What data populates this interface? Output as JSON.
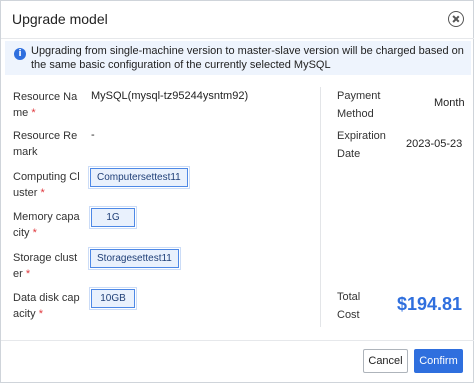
{
  "dialog": {
    "title": "Upgrade model",
    "notice": "Upgrading from single-machine version to master-slave version will be charged based on the same basic configuration of the currently selected MySQL"
  },
  "form": {
    "resource_name_label": "Resource Name",
    "resource_name_required": "*",
    "resource_name_value": "MySQL(mysql-tz95244ysntm92)",
    "resource_remark_label": "Resource Remark",
    "resource_remark_value": "-",
    "computing_cluster_label": "Computing Cluster",
    "computing_cluster_required": "*",
    "computing_cluster_value": "Computersettest11",
    "memory_capacity_label": "Memory capacity",
    "memory_capacity_required": "*",
    "memory_capacity_value": "1G",
    "storage_cluster_label": "Storage cluster",
    "storage_cluster_required": "*",
    "storage_cluster_value": "Storagesettest11",
    "data_disk_capacity_label": "Data disk capacity",
    "data_disk_capacity_required": "*",
    "data_disk_capacity_value": "10GB"
  },
  "summary": {
    "payment_method_label": "Payment Method",
    "payment_method_value": "Month",
    "expiration_date_label": "Expiration Date",
    "expiration_date_value": "2023-05-23",
    "total_cost_label": "Total Cost",
    "total_cost_value": "$194.81"
  },
  "footer": {
    "cancel_label": "Cancel",
    "confirm_label": "Confirm"
  },
  "colors": {
    "accent": "#2f6fde",
    "required": "#e0393e",
    "notice_background": "#eef4fd"
  },
  "icons": {
    "close": "close-circle-icon",
    "info": "info-icon"
  }
}
